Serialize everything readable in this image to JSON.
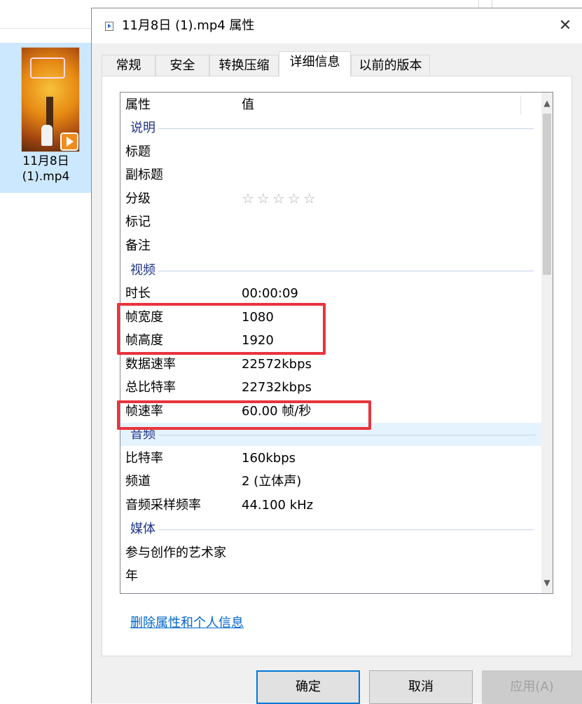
{
  "explorer": {
    "file_name_line1": "11月8日",
    "file_name_line2": "(1).mp4",
    "file_icon": "video-play-icon"
  },
  "dialog": {
    "title": "11月8日 (1).mp4 属性",
    "title_icon": "media-file-icon",
    "close_glyph": "✕",
    "tabs": [
      {
        "label": "常规",
        "active": false
      },
      {
        "label": "安全",
        "active": false
      },
      {
        "label": "转换压缩",
        "active": false
      },
      {
        "label": "详细信息",
        "active": true
      },
      {
        "label": "以前的版本",
        "active": false
      }
    ],
    "list": {
      "header_property": "属性",
      "header_value": "值",
      "groups": {
        "description": "说明",
        "video": "视频",
        "audio": "音频",
        "media": "媒体"
      },
      "rows": {
        "title": {
          "name": "标题",
          "value": ""
        },
        "subtitle": {
          "name": "副标题",
          "value": ""
        },
        "rating": {
          "name": "分级",
          "value": "☆☆☆☆☆",
          "stars": 0
        },
        "tags": {
          "name": "标记",
          "value": ""
        },
        "comments": {
          "name": "备注",
          "value": ""
        },
        "duration": {
          "name": "时长",
          "value": "00:00:09"
        },
        "frame_width": {
          "name": "帧宽度",
          "value": "1080"
        },
        "frame_height": {
          "name": "帧高度",
          "value": "1920"
        },
        "data_rate": {
          "name": "数据速率",
          "value": "22572kbps"
        },
        "total_bitrate": {
          "name": "总比特率",
          "value": "22732kbps"
        },
        "frame_rate": {
          "name": "帧速率",
          "value": "60.00 帧/秒"
        },
        "audio_bitrate": {
          "name": "比特率",
          "value": "160kbps"
        },
        "channels": {
          "name": "频道",
          "value": "2 (立体声)"
        },
        "sample_rate": {
          "name": "音频采样频率",
          "value": "44.100 kHz"
        },
        "contributing_artists": {
          "name": "参与创作的艺术家",
          "value": ""
        },
        "year": {
          "name": "年",
          "value": ""
        }
      }
    },
    "remove_link": "删除属性和个人信息",
    "buttons": {
      "ok": "确定",
      "cancel": "取消",
      "apply": "应用(A)"
    },
    "highlight_color": "#e8343d",
    "link_color": "#0066cc",
    "group_color": "#1e3287"
  }
}
